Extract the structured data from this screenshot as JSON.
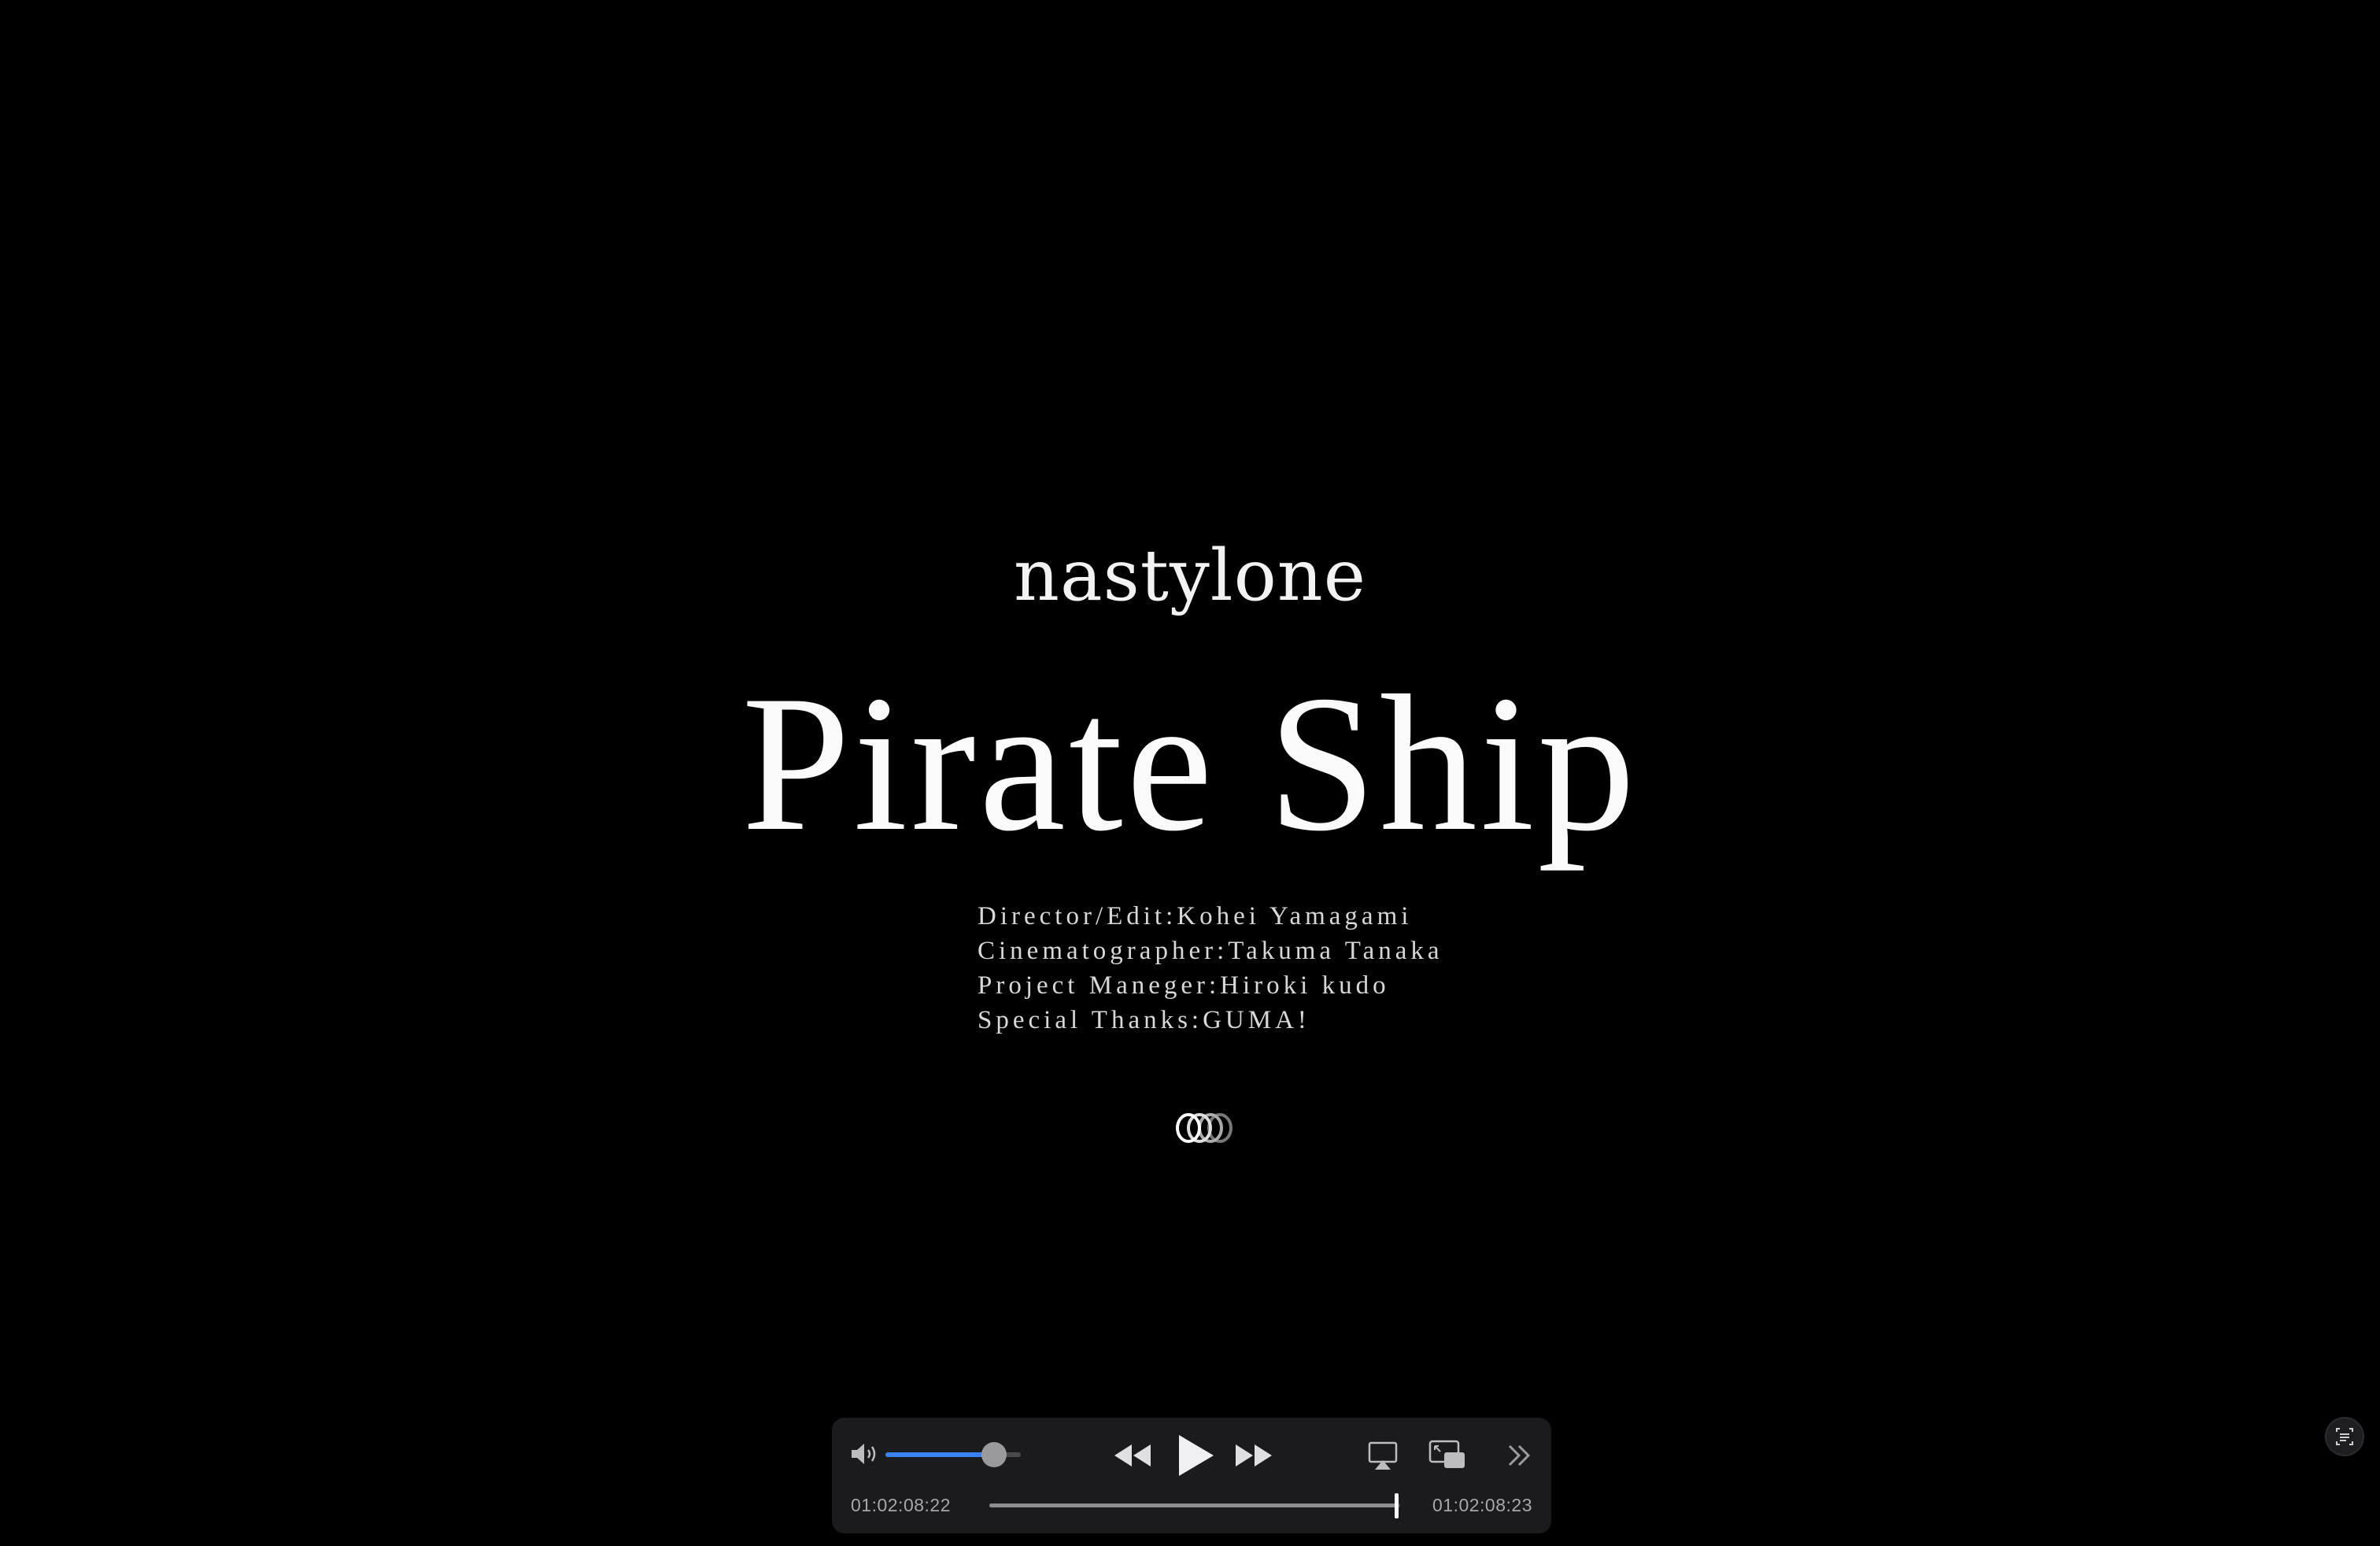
{
  "video": {
    "artist": "nastylone",
    "title": "Pirate Ship",
    "credits": [
      "Director/Edit:Kohei Yamagami",
      "Cinematographer:Takuma Tanaka",
      "Project Maneger:Hiroki kudo",
      "Special Thanks:GUMA!"
    ]
  },
  "player_controls": {
    "volume_level": 0.8,
    "playback_progress": 0.99,
    "time_current": "01:02:08:22",
    "time_remaining": "01:02:08:23",
    "icons": {
      "volume": "speaker-volume-icon",
      "rewind": "rewind-icon",
      "play": "play-icon",
      "fast_forward": "fast-forward-icon",
      "airplay": "airplay-icon",
      "pip": "picture-in-picture-icon",
      "more": "more-chevron-icon",
      "live_text": "live-text-icon"
    },
    "colors": {
      "volume_fill": "#3a82f7",
      "panel": "#1b1b1d"
    }
  }
}
